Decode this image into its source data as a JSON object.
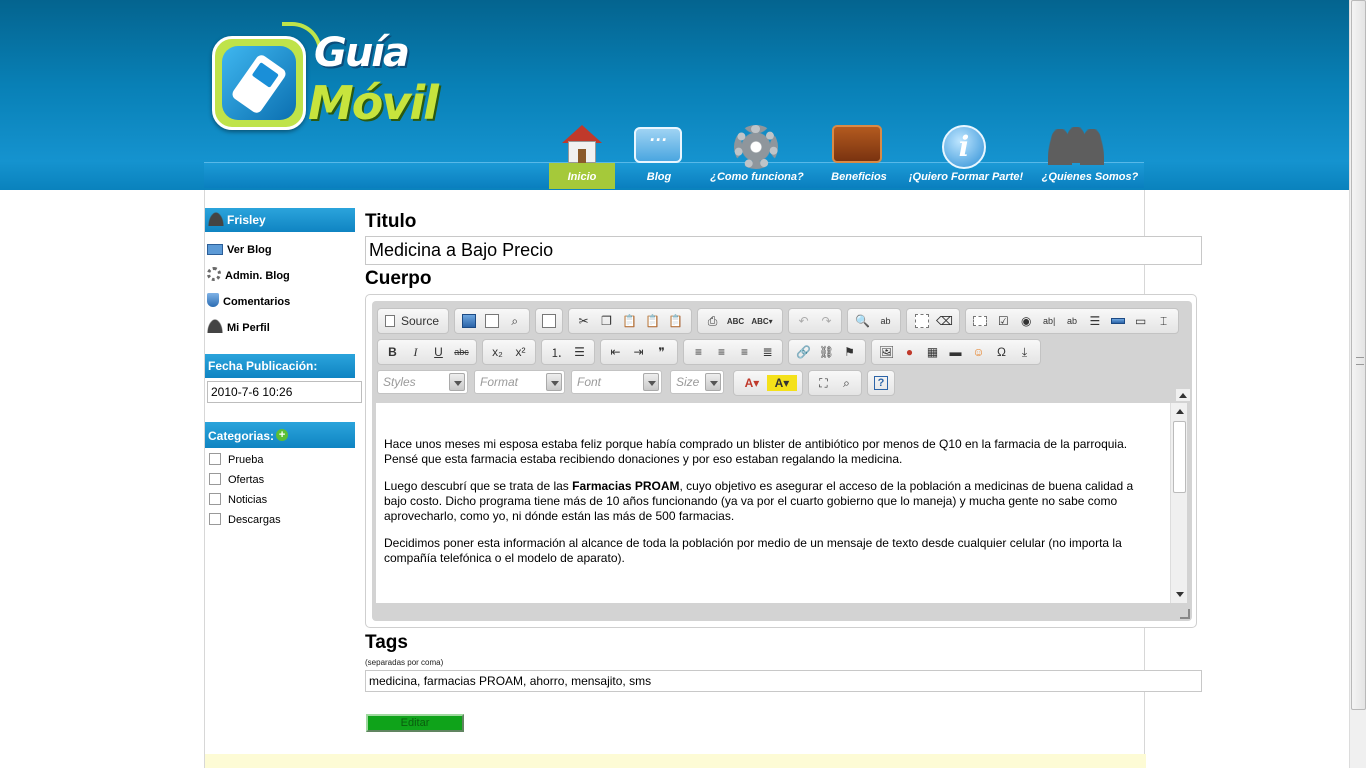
{
  "logo": {
    "line1": "Guía",
    "line2": "Móvil"
  },
  "nav": {
    "items": [
      {
        "label": "Inicio",
        "icon": "home-icon",
        "active": true
      },
      {
        "label": "Blog",
        "icon": "chat-bubble-icon"
      },
      {
        "label": "¿Como funciona?",
        "icon": "gear-icon"
      },
      {
        "label": "Beneficios",
        "icon": "wallet-icon"
      },
      {
        "label": "¡Quiero Formar Parte!",
        "icon": "info-icon"
      },
      {
        "label": "¿Quienes Somos?",
        "icon": "people-icon"
      }
    ]
  },
  "sidebar": {
    "user": "Frisley",
    "links": [
      {
        "label": "Ver Blog",
        "icon": "monitor-icon"
      },
      {
        "label": "Admin. Blog",
        "icon": "gear-icon"
      },
      {
        "label": "Comentarios",
        "icon": "shield-icon"
      },
      {
        "label": "Mi Perfil",
        "icon": "person-icon"
      }
    ],
    "date_heading": "Fecha Publicación:",
    "date_value": "2010-7-6 10:26",
    "categories_heading": "Categorias:",
    "categories": [
      "Prueba",
      "Ofertas",
      "Noticias",
      "Descargas"
    ]
  },
  "form": {
    "title_label": "Titulo",
    "title_value": "Medicina a Bajo Precio",
    "body_label": "Cuerpo",
    "tags_label": "Tags",
    "tags_hint": "(separadas por coma)",
    "tags_value": "medicina, farmacias PROAM, ahorro, mensajito, sms",
    "submit_label": "Editar"
  },
  "editor": {
    "source_label": "Source",
    "combos": {
      "styles": "Styles",
      "format": "Format",
      "font": "Font",
      "size": "Size"
    },
    "content": {
      "p1": "Hace unos meses mi esposa estaba feliz porque había comprado un blister de antibiótico por menos de Q10 en la farmacia de la parroquia. Pensé que esta farmacia estaba recibiendo donaciones y por eso estaban regalando la medicina.",
      "p2_before": "Luego descubrí que se trata de las ",
      "p2_bold": "Farmacias PROAM",
      "p2_after": ", cuyo objetivo es asegurar el acceso de la población a medicinas de buena calidad a bajo costo.  Dicho programa tiene más de 10 años funcionando (ya va por el cuarto gobierno que lo maneja) y mucha gente no sabe como aprovecharlo, como yo, ni dónde están las más de 500 farmacias.",
      "p3": "Decidimos poner esta información al alcance de toda la población por medio de un mensaje de texto desde cualquier celular (no importa la compañía telefónica o el modelo de aparato)."
    }
  },
  "colors": {
    "header_blue": "#0880b6",
    "nav_active": "#a5c93a",
    "sidebar_head": "#1592cf",
    "submit_green": "#0fa31a"
  }
}
